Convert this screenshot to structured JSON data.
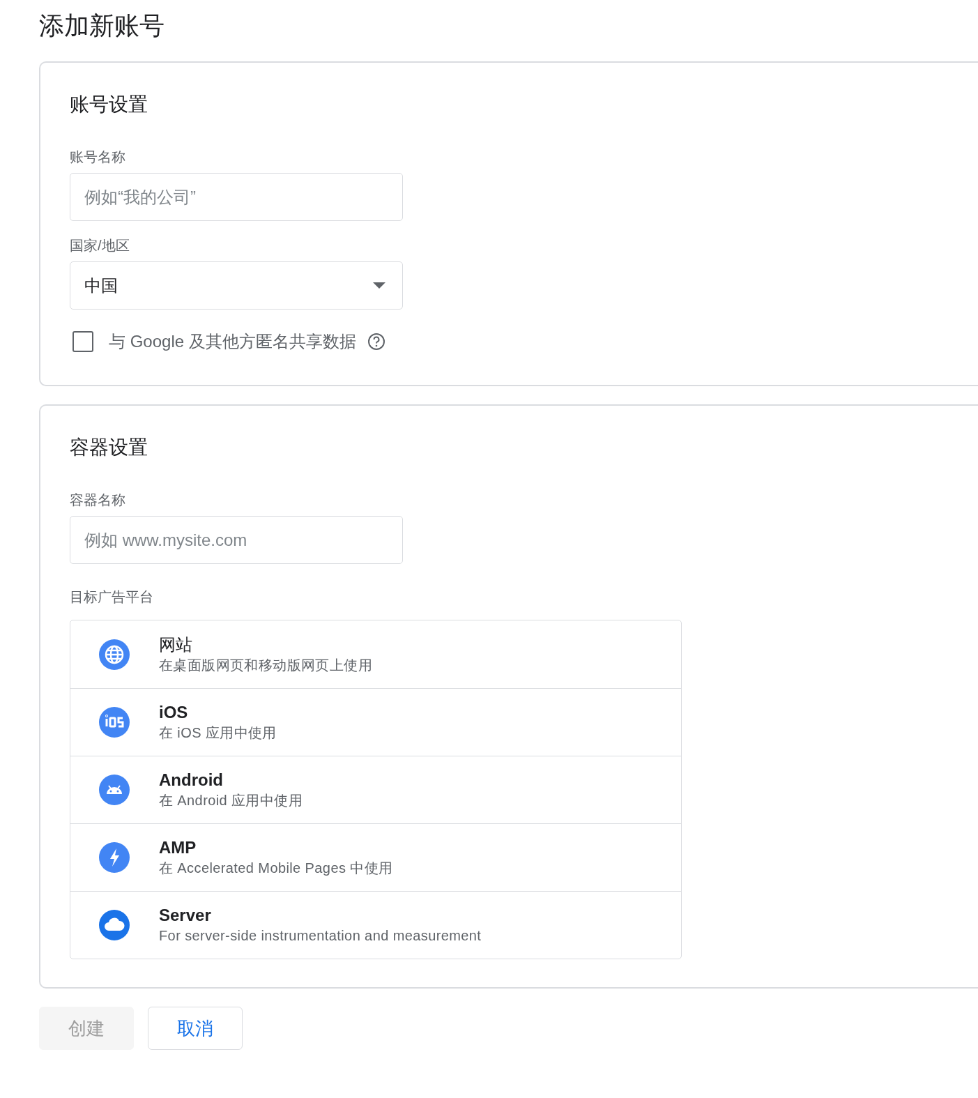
{
  "page_title": "添加新账号",
  "account_settings": {
    "heading": "账号设置",
    "account_name": {
      "label": "账号名称",
      "placeholder": "例如“我的公司”"
    },
    "country": {
      "label": "国家/地区",
      "value": "中国"
    },
    "share_data": {
      "label": "与 Google 及其他方匿名共享数据",
      "checked": false
    }
  },
  "container_settings": {
    "heading": "容器设置",
    "container_name": {
      "label": "容器名称",
      "placeholder": "例如 www.mysite.com"
    },
    "platform_label": "目标广告平台",
    "platforms": [
      {
        "kind": "web",
        "title": "网站",
        "description": "在桌面版网页和移动版网页上使用"
      },
      {
        "kind": "ios",
        "title": "iOS",
        "description": "在 iOS 应用中使用"
      },
      {
        "kind": "android",
        "title": "Android",
        "description": "在 Android 应用中使用"
      },
      {
        "kind": "amp",
        "title": "AMP",
        "description": "在 Accelerated Mobile Pages 中使用"
      },
      {
        "kind": "server",
        "title": "Server",
        "description": "For server-side instrumentation and measurement"
      }
    ]
  },
  "buttons": [
    {
      "label": "创建",
      "disabled": true
    },
    {
      "label": "取消",
      "disabled": false
    }
  ]
}
